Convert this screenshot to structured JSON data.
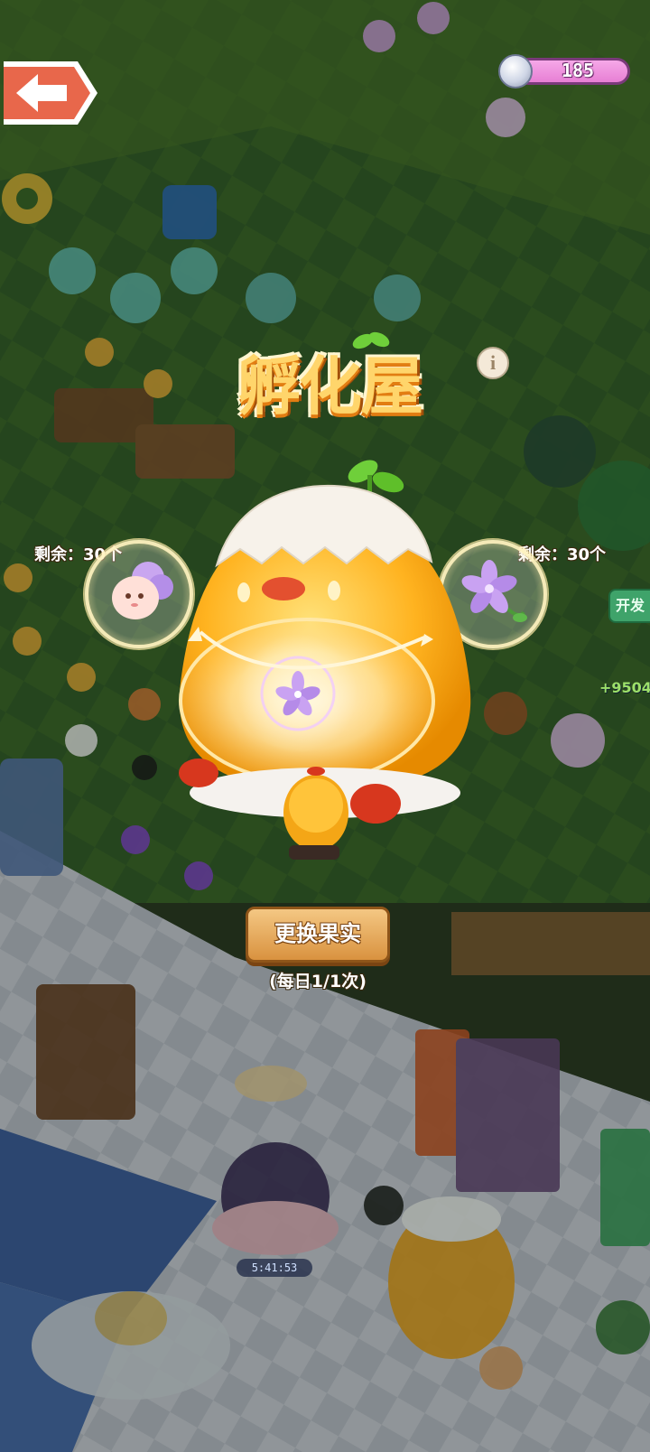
{
  "header": {
    "currency_value": "185"
  },
  "hatchery": {
    "title": "孵化屋",
    "info_symbol": "i",
    "left_remaining": "剩余：30个",
    "right_remaining": "剩余：30个",
    "change_button": "更换果实",
    "daily_limit": "(每日1/1次)"
  },
  "background": {
    "timer": "5:41:53",
    "side_button_label": "开发",
    "side_counter": "+9504"
  },
  "icons": {
    "back": "back-arrow-icon",
    "currency": "silver-coin-icon",
    "info": "info-icon",
    "left_item": "pink-seed-creature-icon",
    "right_item": "purple-flower-icon",
    "incubator": "chick-incubator",
    "center_item": "purple-flower-in-bubble"
  },
  "colors": {
    "currency_pill": "#e77fd4",
    "title_fill": "#ffd56b",
    "title_outline": "#e27d12",
    "button": "#d9923f",
    "back_button": "#e8674b"
  }
}
